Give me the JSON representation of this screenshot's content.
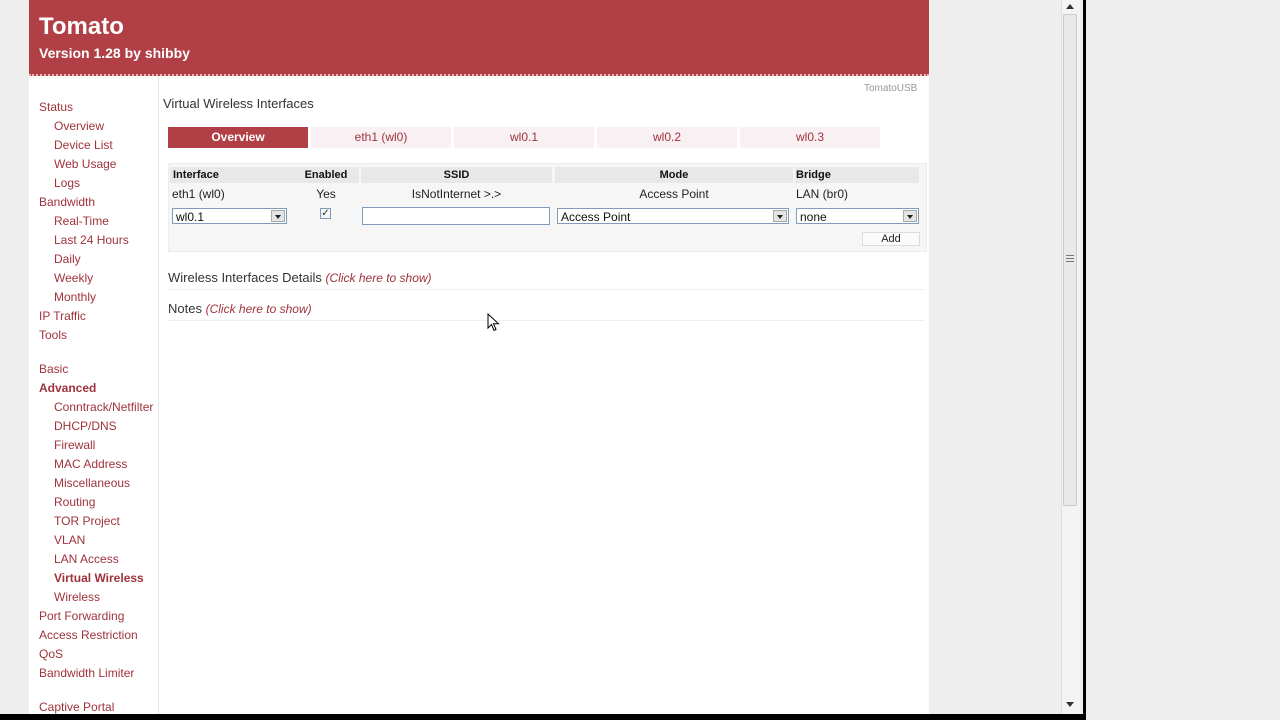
{
  "header": {
    "title": "Tomato",
    "version": "Version 1.28 by shibby",
    "brand_color": "#b03f46"
  },
  "sidebar": {
    "items": [
      {
        "label": "Status"
      },
      {
        "label": "Overview"
      },
      {
        "label": "Device List"
      },
      {
        "label": "Web Usage"
      },
      {
        "label": "Logs"
      },
      {
        "label": "Bandwidth"
      },
      {
        "label": "Real-Time"
      },
      {
        "label": "Last 24 Hours"
      },
      {
        "label": "Daily"
      },
      {
        "label": "Weekly"
      },
      {
        "label": "Monthly"
      },
      {
        "label": "IP Traffic"
      },
      {
        "label": "Tools"
      },
      {
        "label": "Basic"
      },
      {
        "label": "Advanced"
      },
      {
        "label": "Conntrack/Netfilter"
      },
      {
        "label": "DHCP/DNS"
      },
      {
        "label": "Firewall"
      },
      {
        "label": "MAC Address"
      },
      {
        "label": "Miscellaneous"
      },
      {
        "label": "Routing"
      },
      {
        "label": "TOR Project"
      },
      {
        "label": "VLAN"
      },
      {
        "label": "LAN Access"
      },
      {
        "label": "Virtual Wireless"
      },
      {
        "label": "Wireless"
      },
      {
        "label": "Port Forwarding"
      },
      {
        "label": "Access Restriction"
      },
      {
        "label": "QoS"
      },
      {
        "label": "Bandwidth Limiter"
      },
      {
        "label": "Captive Portal"
      }
    ]
  },
  "main": {
    "brand": "TomatoUSB",
    "section_title": "Virtual Wireless Interfaces",
    "tabs": [
      {
        "label": "Overview",
        "active": true
      },
      {
        "label": "eth1 (wl0)"
      },
      {
        "label": "wl0.1"
      },
      {
        "label": "wl0.2"
      },
      {
        "label": "wl0.3"
      }
    ],
    "table": {
      "headers": {
        "interface": "Interface",
        "enabled": "Enabled",
        "ssid": "SSID",
        "mode": "Mode",
        "bridge": "Bridge"
      },
      "row": {
        "interface": "eth1 (wl0)",
        "enabled": "Yes",
        "ssid": "IsNotInternet >.>",
        "mode": "Access Point",
        "bridge": "LAN (br0)"
      },
      "new_row": {
        "interface": "wl0.1",
        "enabled_check": "✓",
        "ssid": "",
        "mode": "Access Point",
        "bridge": "none"
      },
      "add_label": "Add"
    },
    "details": {
      "title": "Wireless Interfaces Details",
      "link": "(Click here to show)"
    },
    "notes": {
      "title": "Notes",
      "link": "(Click here to show)"
    }
  }
}
